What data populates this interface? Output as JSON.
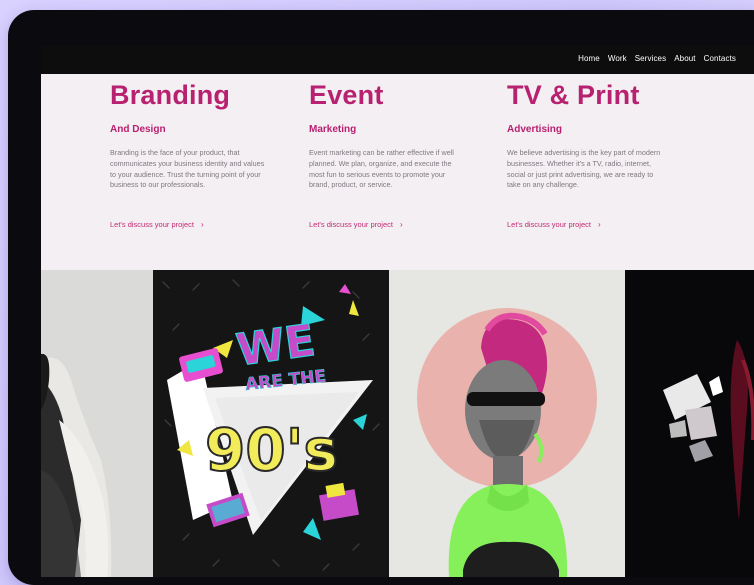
{
  "nav": {
    "items": [
      "Home",
      "Work",
      "Services",
      "About",
      "Contacts"
    ]
  },
  "services": [
    {
      "title": "Branding",
      "subtitle": "And Design",
      "description": "Branding is the face of your product, that communicates your business identity and values to your audience. Trust the turning point of your business to our professionals.",
      "link": "Let's discuss your project"
    },
    {
      "title": "Event",
      "subtitle": "Marketing",
      "description": "Event marketing can be rather effective if well planned. We plan, organize, and execute the most fun to serious events to promote your brand, product, or service.",
      "link": "Let's discuss your project"
    },
    {
      "title": "TV & Print",
      "subtitle": "Advertising",
      "description": "We believe advertising is the key part of modern businesses. Whether it's a TV, radio, internet, social or just print advertising, we are ready to take on any challenge.",
      "link": "Let's discuss your project"
    }
  ],
  "poster": {
    "line1": "WE",
    "line2": "ARE THE",
    "line3": "90's"
  },
  "colors": {
    "accent": "#b82070",
    "hero_bg": "#f3eff2",
    "navbar_bg": "#0d0d0d",
    "page_bg": "#d9d2ff"
  },
  "icons": {
    "link_chevron": "chevron-right-icon"
  }
}
